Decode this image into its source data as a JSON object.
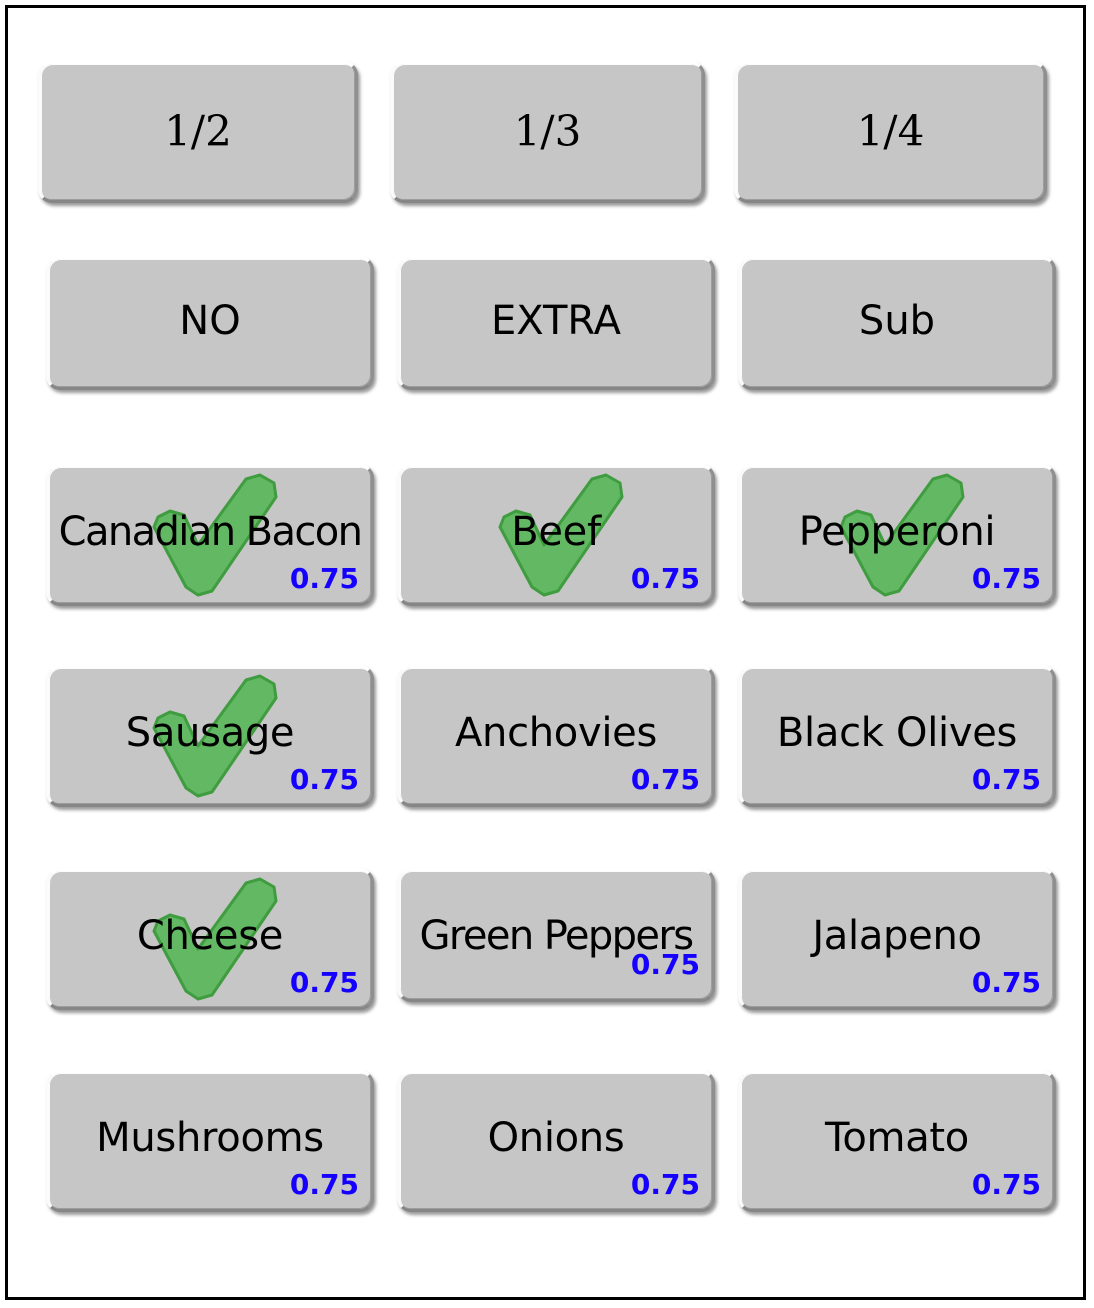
{
  "screen": {
    "title": "Pizza Topping Selection Keypad",
    "background_color": "#ffffff",
    "frame_color": "#000000",
    "button_face_color": "#c6c6c6",
    "price_color": "#1500ff",
    "check_color": "#5cb85c"
  },
  "fraction_buttons": [
    {
      "label": "1/2",
      "name": "half-button"
    },
    {
      "label": "1/3",
      "name": "third-button"
    },
    {
      "label": "1/4",
      "name": "quarter-button"
    }
  ],
  "modifier_buttons": [
    {
      "label": "NO",
      "name": "no-button"
    },
    {
      "label": "EXTRA",
      "name": "extra-button"
    },
    {
      "label": "Sub",
      "name": "sub-button"
    }
  ],
  "toppings": [
    {
      "label": "Canadian Bacon",
      "price": "0.75",
      "selected": true,
      "name": "topping-canadian-bacon"
    },
    {
      "label": "Beef",
      "price": "0.75",
      "selected": true,
      "name": "topping-beef"
    },
    {
      "label": "Pepperoni",
      "price": "0.75",
      "selected": true,
      "name": "topping-pepperoni"
    },
    {
      "label": "Sausage",
      "price": "0.75",
      "selected": true,
      "name": "topping-sausage"
    },
    {
      "label": "Anchovies",
      "price": "0.75",
      "selected": false,
      "name": "topping-anchovies"
    },
    {
      "label": "Black Olives",
      "price": "0.75",
      "selected": false,
      "name": "topping-black-olives"
    },
    {
      "label": "Cheese",
      "price": "0.75",
      "selected": true,
      "name": "topping-cheese"
    },
    {
      "label": "Green Peppers",
      "price": "0.75",
      "selected": false,
      "name": "topping-green-peppers"
    },
    {
      "label": "Jalapeno",
      "price": "0.75",
      "selected": false,
      "name": "topping-jalapeno"
    },
    {
      "label": "Mushrooms",
      "price": "0.75",
      "selected": false,
      "name": "topping-mushrooms"
    },
    {
      "label": "Onions",
      "price": "0.75",
      "selected": false,
      "name": "topping-onions"
    },
    {
      "label": "Tomato",
      "price": "0.75",
      "selected": false,
      "name": "topping-tomato"
    }
  ]
}
